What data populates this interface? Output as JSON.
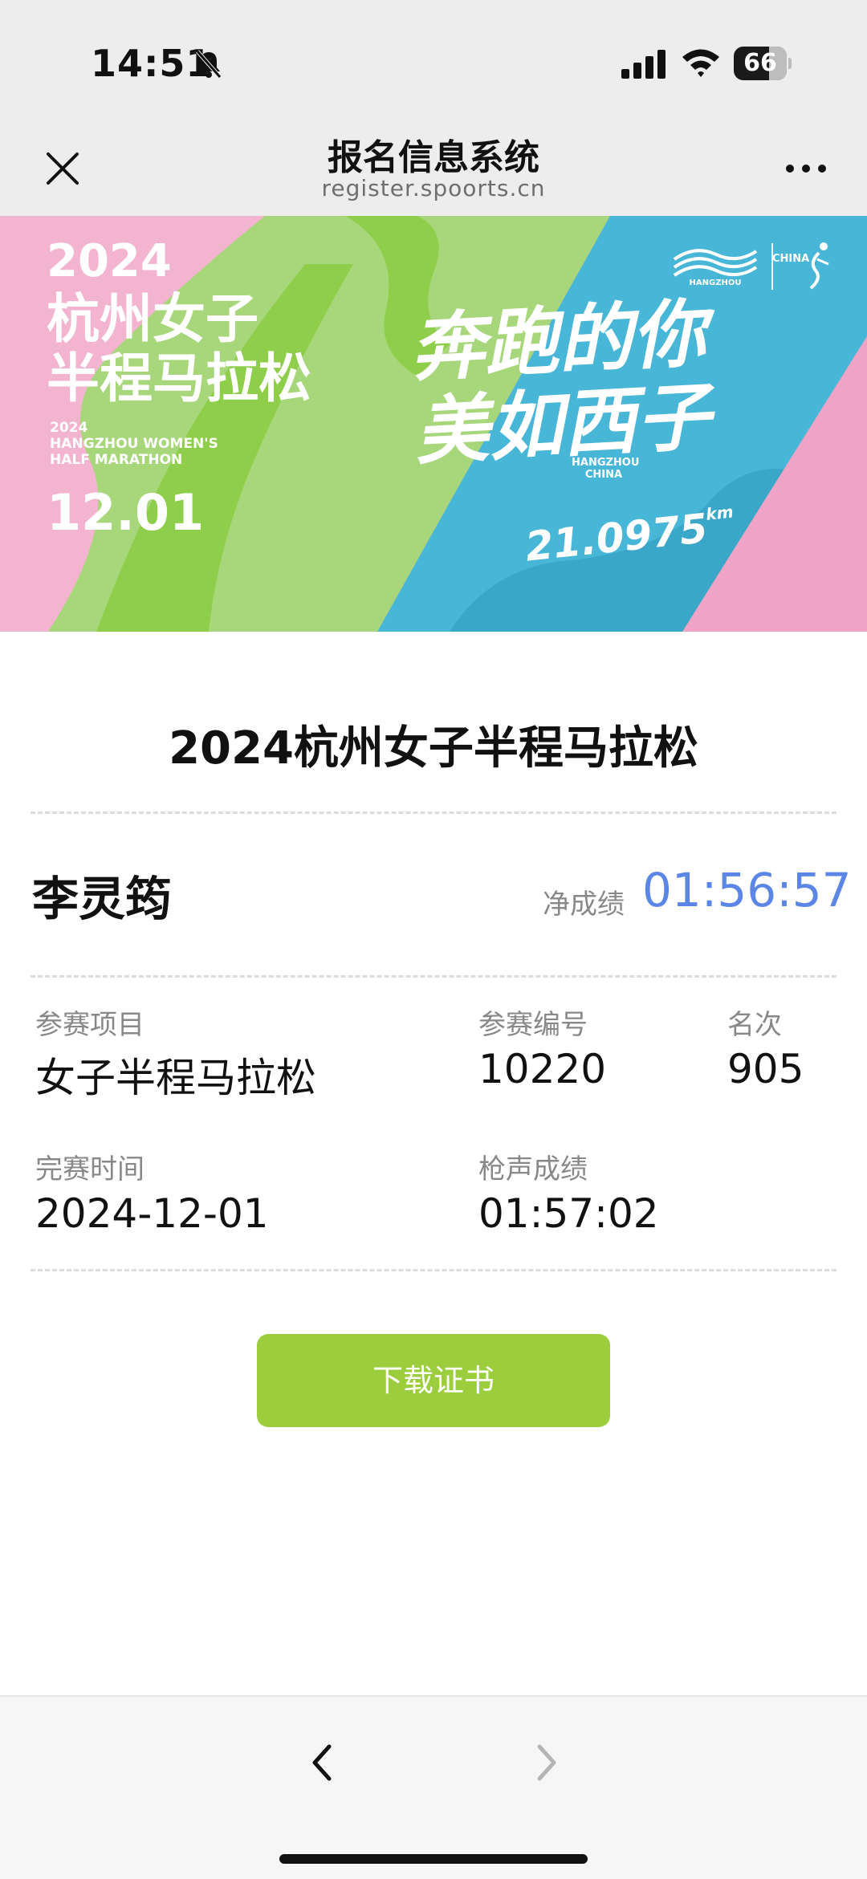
{
  "status_bar": {
    "time": "14:51",
    "battery_level": "66",
    "icons": [
      "mute-bell-icon",
      "cellular-signal-icon",
      "wifi-icon",
      "battery-icon"
    ]
  },
  "nav": {
    "title": "报名信息系统",
    "url": "register.spoorts.cn",
    "close_icon": "close-icon",
    "more_icon": "more-icon"
  },
  "banner": {
    "year": "2024",
    "title_cn_line1": "杭州女子",
    "title_cn_line2": "半程马拉松",
    "title_en": [
      "2024",
      "HANGZHOU WOMEN'S",
      "HALF MARATHON"
    ],
    "date": "12.01",
    "slogan_line1": "奔跑的你",
    "slogan_line2": "美如西子",
    "city_en": [
      "HANGZHOU",
      "CHINA"
    ],
    "distance": "21.0975",
    "distance_unit": "km",
    "logo_left_text": "HANGZHOU",
    "logo_right_text": "CHINA",
    "colors": {
      "pink": "#efa3c6",
      "green": "#9ed463",
      "blue": "#4bb8d8"
    }
  },
  "result": {
    "event_title": "2024杭州女子半程马拉松",
    "runner_name": "李灵筠",
    "net_time_label": "净成绩",
    "net_time": "01:56:57",
    "fields": {
      "event_label": "参赛项目",
      "event_value": "女子半程马拉松",
      "bib_label": "参赛编号",
      "bib_value": "10220",
      "rank_label": "名次",
      "rank_value": "905",
      "finish_date_label": "完赛时间",
      "finish_date_value": "2024-12-01",
      "gun_time_label": "枪声成绩",
      "gun_time_value": "01:57:02"
    },
    "download_button": "下载证书",
    "accent_color": "#9ccd3c",
    "net_time_color": "#5b86e5"
  },
  "bottom_bar": {
    "back_icon": "chevron-left-icon",
    "forward_icon": "chevron-right-icon"
  }
}
